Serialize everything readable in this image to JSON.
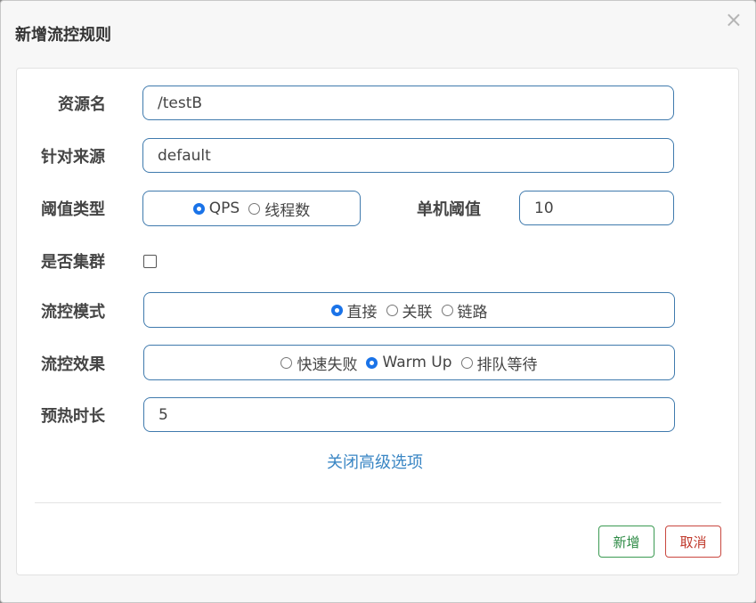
{
  "dialog": {
    "title": "新增流控规则",
    "close_symbol": "×"
  },
  "form": {
    "resource_name": {
      "label": "资源名",
      "value": "/testB"
    },
    "limit_app": {
      "label": "针对来源",
      "value": "default"
    },
    "threshold_type": {
      "label": "阈值类型",
      "options": [
        {
          "label": "QPS",
          "selected": true
        },
        {
          "label": "线程数",
          "selected": false
        }
      ]
    },
    "single_threshold": {
      "label": "单机阈值",
      "value": "10"
    },
    "cluster_mode": {
      "label": "是否集群",
      "checked": false
    },
    "control_mode": {
      "label": "流控模式",
      "options": [
        {
          "label": "直接",
          "selected": true
        },
        {
          "label": "关联",
          "selected": false
        },
        {
          "label": "链路",
          "selected": false
        }
      ]
    },
    "control_effect": {
      "label": "流控效果",
      "options": [
        {
          "label": "快速失败",
          "selected": false
        },
        {
          "label": "Warm Up",
          "selected": true
        },
        {
          "label": "排队等待",
          "selected": false
        }
      ]
    },
    "warmup_period": {
      "label": "预热时长",
      "value": "5"
    },
    "advanced_toggle": "关闭高级选项"
  },
  "footer": {
    "add_label": "新增",
    "cancel_label": "取消"
  },
  "colors": {
    "input_border": "#3f7aad",
    "radio_selected": "#1a73e8",
    "link": "#3a86c4",
    "add_button": "#2e8b46",
    "cancel_button": "#c0392b"
  }
}
